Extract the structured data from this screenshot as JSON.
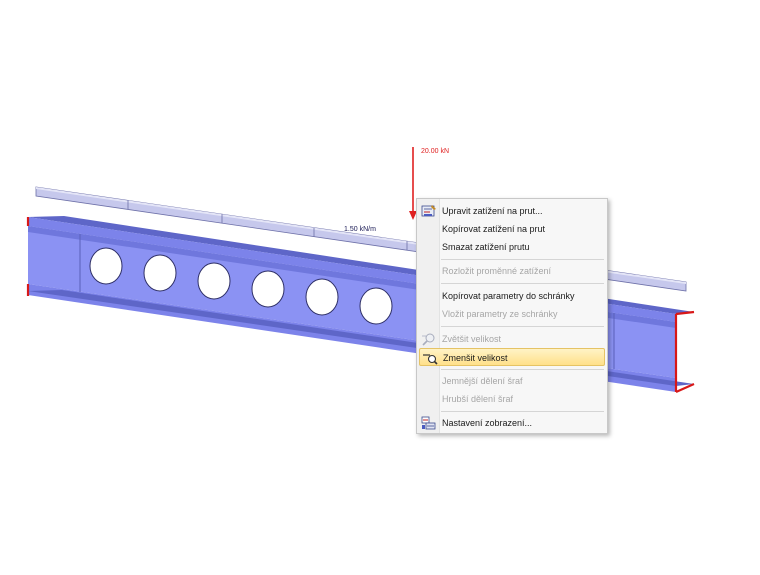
{
  "model_view": {
    "point_load_label": "20.00 kN",
    "line_load_label": "1.50 kN/m",
    "colors": {
      "beam": "#7f86f0",
      "beam_dark": "#5e66c8",
      "load_bar": "#c6c8ec",
      "point_load": "#e02020",
      "support_end": "#d81818"
    }
  },
  "context_menu": {
    "items": [
      {
        "label": "Upravit zatížení na prut...",
        "icon": "edit-member-load-icon",
        "enabled": true
      },
      {
        "label": "Kopírovat zatížení na prut",
        "enabled": true
      },
      {
        "label": "Smazat zatížení prutu",
        "enabled": true
      },
      {
        "label": "Rozložit proměnné zatížení",
        "enabled": false
      },
      {
        "label": "Kopírovat parametry do schránky",
        "enabled": true
      },
      {
        "label": "Vložit parametry ze schránky",
        "enabled": false
      },
      {
        "label": "Zvětšit velikost",
        "icon": "zoom-in-icon",
        "enabled": false
      },
      {
        "label": "Zmenšit velikost",
        "icon": "zoom-out-icon",
        "enabled": true,
        "highlighted": true
      },
      {
        "label": "Jemnější dělení šraf",
        "enabled": false
      },
      {
        "label": "Hrubší dělení šraf",
        "enabled": false
      },
      {
        "label": "Nastavení zobrazení...",
        "icon": "display-settings-icon",
        "enabled": true
      }
    ]
  }
}
